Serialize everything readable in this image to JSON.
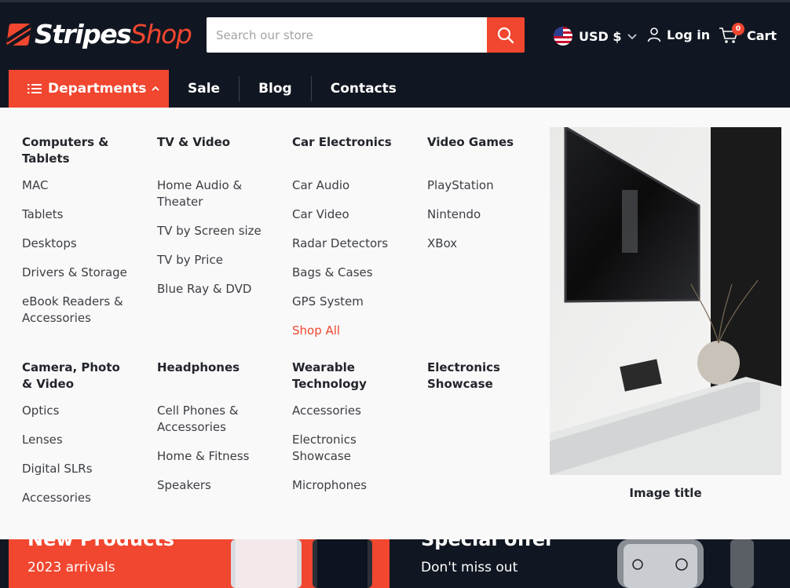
{
  "brand": {
    "part1": "Stripes",
    "part2": "Shop"
  },
  "search": {
    "placeholder": "Search our store"
  },
  "currency": {
    "label": "USD $"
  },
  "account": {
    "login_label": "Log in"
  },
  "cart": {
    "label": "Cart",
    "count": "0"
  },
  "nav": {
    "departments": "Departments",
    "sale": "Sale",
    "blog": "Blog",
    "contacts": "Contacts"
  },
  "menu": {
    "computers": {
      "title": "Computers & Tablets",
      "items": [
        "MAC",
        "Tablets",
        "Desktops",
        "Drivers & Storage",
        "eBook Readers & Accessories"
      ]
    },
    "tv": {
      "title": "TV & Video",
      "items": [
        "Home Audio & Theater",
        "TV by Screen size",
        "TV by Price",
        "Blue Ray & DVD"
      ]
    },
    "car": {
      "title": "Car Electronics",
      "items": [
        "Car Audio",
        "Car Video",
        "Radar Detectors",
        "Bags & Cases",
        "GPS System",
        "Shop All"
      ]
    },
    "games": {
      "title": "Video Games",
      "items": [
        "PlayStation",
        "Nintendo",
        "XBox"
      ]
    },
    "camera": {
      "title": "Camera, Photo & Video",
      "items": [
        "Optics",
        "Lenses",
        "Digital SLRs",
        "Accessories"
      ]
    },
    "headphones": {
      "title": "Headphones",
      "items": [
        "Cell Phones & Accessories",
        "Home & Fitness",
        "Speakers"
      ]
    },
    "wearable": {
      "title": "Wearable Technology",
      "items": [
        "Accessories",
        "Electronics Showcase",
        "Microphones"
      ]
    },
    "showcase": {
      "title": "Electronics Showcase"
    },
    "image_title": "Image title"
  },
  "banners": {
    "left": {
      "title": "New Products",
      "subtitle": "2023 arrivals"
    },
    "right": {
      "title": "Special offer",
      "subtitle": "Don't miss out"
    }
  },
  "colors": {
    "accent": "#f1462f",
    "header_bg": "#111722",
    "menu_bg": "#f9f9f9"
  }
}
